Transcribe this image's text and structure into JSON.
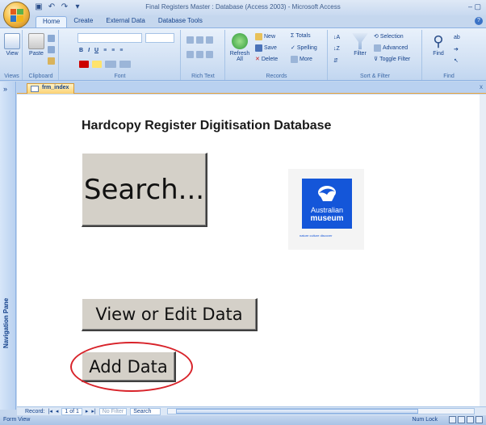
{
  "window": {
    "title": "Final Registers Master : Database (Access 2003) - Microsoft Access",
    "controls": "– ▢"
  },
  "ribbon_tabs": [
    "Home",
    "Create",
    "External Data",
    "Database Tools"
  ],
  "ribbon": {
    "views": {
      "label": "Views",
      "view_btn": "View"
    },
    "clipboard": {
      "label": "Clipboard",
      "paste_btn": "Paste"
    },
    "font": {
      "label": "Font"
    },
    "rich_text": {
      "label": "Rich Text"
    },
    "records": {
      "label": "Records",
      "refresh_btn": "Refresh All",
      "new": "New",
      "save": "Save",
      "delete": "Delete",
      "totals": "Totals",
      "spelling": "Spelling",
      "more": "More"
    },
    "sort_filter": {
      "label": "Sort & Filter",
      "filter_btn": "Filter",
      "selection": "Selection",
      "advanced": "Advanced",
      "toggle_filter": "Toggle Filter"
    },
    "find": {
      "label": "Find",
      "find_btn": "Find"
    }
  },
  "nav_pane": {
    "label": "Navigation Pane",
    "toggle": "»"
  },
  "doc_tab": {
    "name": "frm_index",
    "close": "x"
  },
  "form": {
    "title": "Hardcopy Register Digitisation Database",
    "search_btn": "Search...",
    "view_edit_btn": "View or Edit Data",
    "add_btn": "Add Data",
    "logo": {
      "line1": "Australian",
      "line2": "museum",
      "tagline": "nature culture discover"
    }
  },
  "record_nav": {
    "label": "Record:",
    "first": "|◂",
    "prev": "◂",
    "position": "1 of 1",
    "next": "▸",
    "last": "▸|",
    "filter_status": "No Filter",
    "search_placeholder": "Search"
  },
  "status_bar": {
    "left": "Form View",
    "right": "Num Lock"
  },
  "colors": {
    "logo_blue": "#1456d9",
    "highlight_circle": "#d8232a",
    "button_face": "#d4d0c8"
  }
}
